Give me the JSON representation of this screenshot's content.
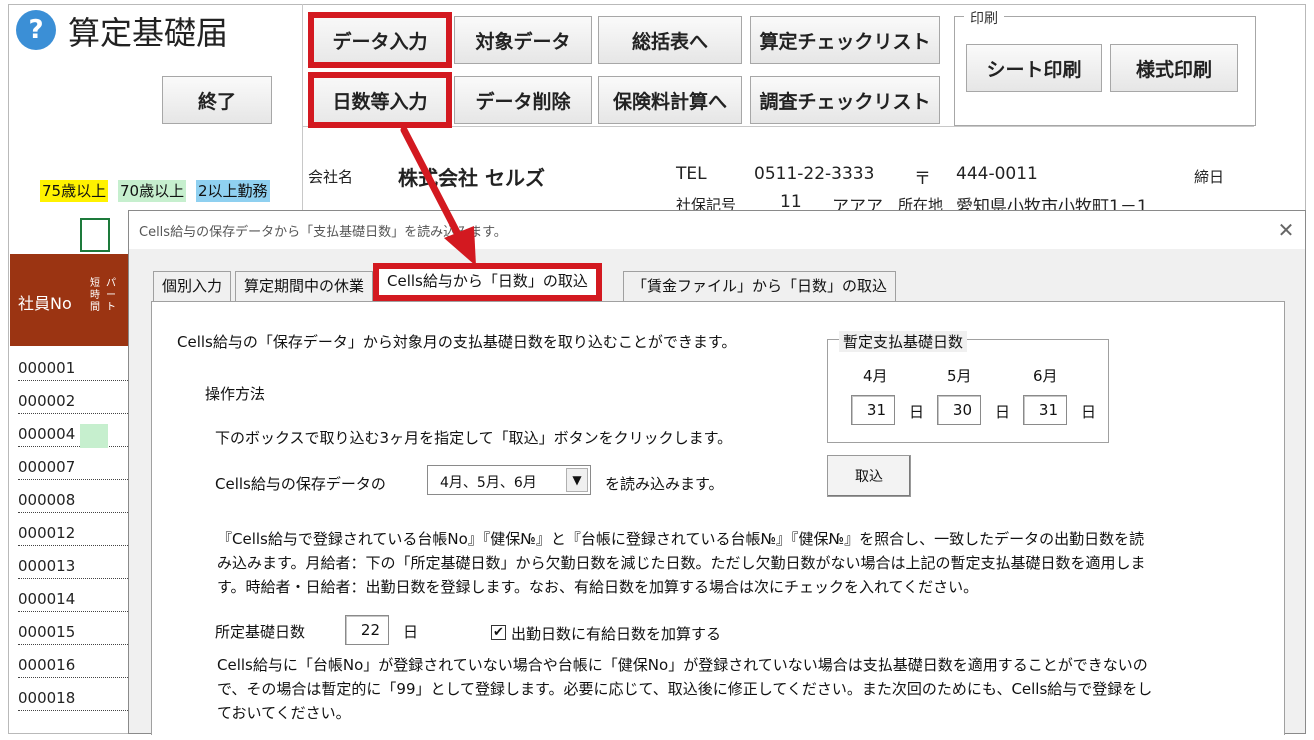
{
  "app": {
    "title": "算定基礎届",
    "help_glyph": "?",
    "exit_label": "終了"
  },
  "toolbar": {
    "row1": [
      "データ入力",
      "対象データ",
      "総括表へ",
      "算定チェックリスト"
    ],
    "row2": [
      "日数等入力",
      "データ削除",
      "保険料計算へ",
      "調査チェックリスト"
    ],
    "print_group_label": "印刷",
    "print_buttons": [
      "シート印刷",
      "様式印刷"
    ]
  },
  "company": {
    "name_label": "会社名",
    "name_value": "株式会社 セルズ",
    "tel_label": "TEL",
    "tel_value": "0511-22-3333",
    "postal_label": "〒",
    "postal_value": "444-0011",
    "deadline_label": "締日",
    "insurance_label": "社保記号",
    "insurance_no": "11",
    "insurance_kana": "アアア",
    "address_label": "所在地",
    "address_value": "愛知県小牧市小牧町1－1"
  },
  "legend_tags": [
    {
      "label": "75歳以上",
      "color": "#fff200"
    },
    {
      "label": "70歳以上",
      "color": "#c6efce"
    },
    {
      "label": "2以上勤務",
      "color": "#8fd0f0"
    }
  ],
  "employee_table": {
    "header_no": "社員No",
    "header_part": "短時間",
    "header_pa": "パート",
    "rows": [
      "000001",
      "000002",
      "000004",
      "000007",
      "000008",
      "000012",
      "000013",
      "000014",
      "000015",
      "000016",
      "000018"
    ],
    "marked_row_index": 2
  },
  "dialog": {
    "title": "Cells給与の保存データから「支払基礎日数」を読み込みます。",
    "close_glyph": "✕",
    "tabs": [
      "個別入力",
      "算定期間中の休業",
      "Cells給与から「日数」の取込",
      "「賃金ファイル」から「日数」の取込"
    ],
    "active_tab_index": 2,
    "intro": "Cells給与の「保存データ」から対象月の支払基礎日数を取り込むことができます。",
    "method_heading": "操作方法",
    "method_line": "下のボックスで取り込む3ヶ月を指定して「取込」ボタンをクリックします。",
    "source_prefix": "Cells給与の保存データの",
    "source_suffix": "を読み込みます。",
    "month_select": "4月、5月、6月",
    "provisional_label": "暫定支払基礎日数",
    "months": [
      {
        "label": "4月",
        "value": "31"
      },
      {
        "label": "5月",
        "value": "30"
      },
      {
        "label": "6月",
        "value": "31"
      }
    ],
    "day_unit": "日",
    "import_button": "取込",
    "desc": [
      "『Cells給与で登録されている台帳No』『健保№』と『台帳に登録されている台帳№』『健保№』を照合し、一致したデータの出勤日数を読",
      "み込みます。月給者：下の「所定基礎日数」から欠勤日数を減じた日数。ただし欠勤日数がない場合は上記の暫定支払基礎日数を適用しま",
      "す。時給者・日給者：出勤日数を登録します。なお、有給日数を加算する場合は次にチェックを入れてください。"
    ],
    "base_days_label": "所定基礎日数",
    "base_days_value": "22",
    "add_paid_label": "出勤日数に有給日数を加算する",
    "add_paid_checked": true,
    "check_glyph": "✔",
    "note": [
      "Cells給与に「台帳No」が登録されていない場合や台帳に「健保No」が登録されていない場合は支払基礎日数を適用することができないの",
      "で、その場合は暫定的に「99」として登録します。必要に応じて、取込後に修正してください。また次回のためにも、Cells給与で登録をし",
      "ておいてください。"
    ]
  },
  "colors": {
    "highlight": "#d31920",
    "header_brown": "#9b3412"
  }
}
